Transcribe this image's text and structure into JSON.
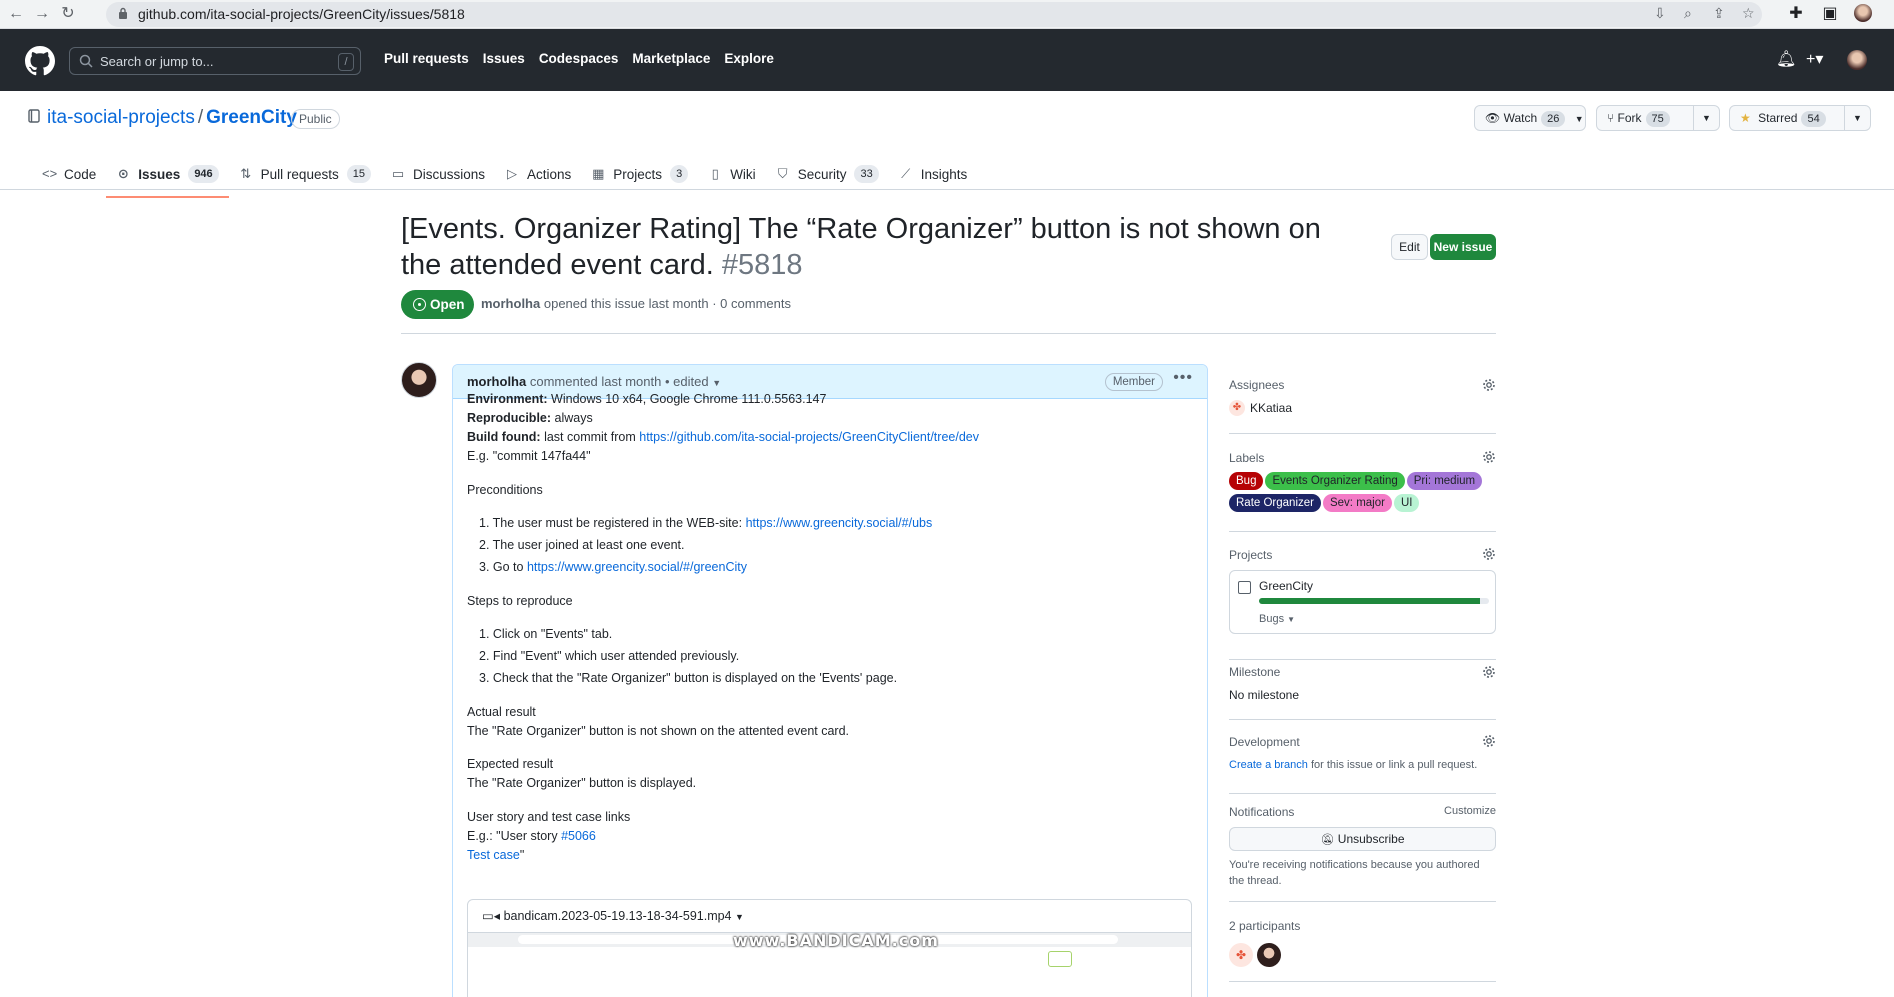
{
  "browser": {
    "url": "github.com/ita-social-projects/GreenCity/issues/5818"
  },
  "header": {
    "search_placeholder": "Search or jump to...",
    "search_shortcut": "/",
    "nav": [
      "Pull requests",
      "Issues",
      "Codespaces",
      "Marketplace",
      "Explore"
    ]
  },
  "repo": {
    "owner": "ita-social-projects",
    "separator": "/",
    "name": "GreenCity",
    "visibility": "Public",
    "watch_label": "Watch",
    "watch_count": "26",
    "fork_label": "Fork",
    "fork_count": "75",
    "star_label": "Starred",
    "star_count": "54",
    "tabs": [
      {
        "label": "Code",
        "count": ""
      },
      {
        "label": "Issues",
        "count": "946"
      },
      {
        "label": "Pull requests",
        "count": "15"
      },
      {
        "label": "Discussions",
        "count": ""
      },
      {
        "label": "Actions",
        "count": ""
      },
      {
        "label": "Projects",
        "count": "3"
      },
      {
        "label": "Wiki",
        "count": ""
      },
      {
        "label": "Security",
        "count": "33"
      },
      {
        "label": "Insights",
        "count": ""
      }
    ]
  },
  "issue": {
    "title": "[Events. Organizer Rating] The “Rate Organizer” button is not shown on the attended event card.",
    "number": "#5818",
    "edit_label": "Edit",
    "new_issue_label": "New issue",
    "state": "Open",
    "author": "morholha",
    "meta_text": "opened this issue last month · 0 comments"
  },
  "comment": {
    "author": "morholha",
    "meta": "commented last month • edited",
    "role": "Member",
    "env_label": "Environment:",
    "env_value": "Windows 10 x64, Google Chrome 111.0.5563.147",
    "repro_label": "Reproducible:",
    "repro_value": "always",
    "build_label": "Build found:",
    "build_value": "last commit from",
    "build_link": "https://github.com/ita-social-projects/GreenCityClient/tree/dev",
    "eg_commit": "E.g. \"commit 147fa44\"",
    "preconditions_title": "Preconditions",
    "pre1_text": "The user must be registered in the WEB-site:",
    "pre1_link": "https://www.greencity.social/#/ubs",
    "pre2_text": "The user joined at least one event.",
    "pre3_text": "Go to",
    "pre3_link": "https://www.greencity.social/#/greenCity",
    "steps_title": "Steps to reproduce",
    "step1": "Click on \"Events\" tab.",
    "step2": "Find \"Event\" which user attended previously.",
    "step3": "Check that the \"Rate Organizer\" button is displayed on the 'Events' page.",
    "actual_title": "Actual result",
    "actual_text": "The \"Rate Organizer\" button is not shown on the attented event card.",
    "expected_title": "Expected result",
    "expected_text": "The \"Rate Organizer\" button is displayed.",
    "story_title": "User story and test case links",
    "story_text": "E.g.: \"User story",
    "story_link": "#5066",
    "test_case_link": "Test case",
    "test_case_suffix": "\"",
    "video_name": "bandicam.2023-05-19.13-18-34-591.mp4",
    "watermark": "www.BANDICAM.com"
  },
  "sidebar": {
    "assignees_title": "Assignees",
    "assignee": "KKatiaa",
    "labels_title": "Labels",
    "labels": [
      {
        "text": "Bug",
        "bg": "#b60205",
        "fg": "#ffffff"
      },
      {
        "text": "Events Organizer Rating",
        "bg": "#3cbf4a",
        "fg": "#1f2328"
      },
      {
        "text": "Pri: medium",
        "bg": "#a476d8",
        "fg": "#1f2328"
      },
      {
        "text": "Rate Organizer",
        "bg": "#1d2566",
        "fg": "#ffffff"
      },
      {
        "text": "Sev: major",
        "bg": "#f37bc6",
        "fg": "#1f2328"
      },
      {
        "text": "UI",
        "bg": "#b8f3d3",
        "fg": "#1f2328"
      }
    ],
    "projects_title": "Projects",
    "project_name": "GreenCity",
    "project_progress": 0.96,
    "project_status": "Bugs",
    "milestone_title": "Milestone",
    "milestone_value": "No milestone",
    "development_title": "Development",
    "dev_link": "Create a branch",
    "dev_text": "for this issue or link a pull request.",
    "notifications_title": "Notifications",
    "customize": "Customize",
    "unsubscribe": "Unsubscribe",
    "notif_reason": "You're receiving notifications because you authored the thread.",
    "participants": "2 participants"
  }
}
